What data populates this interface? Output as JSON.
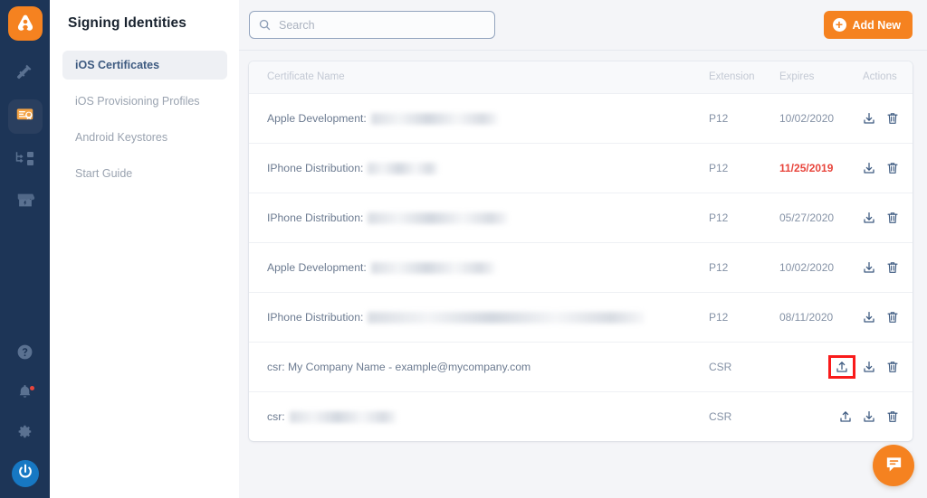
{
  "rail": {
    "logo_icon": "app-logo-icon",
    "items": [
      {
        "icon": "hammer-icon",
        "name": "rail-item-build",
        "active": false
      },
      {
        "icon": "certificate-icon",
        "name": "rail-item-signing-identities",
        "active": true
      },
      {
        "icon": "workflow-icon",
        "name": "rail-item-workflows",
        "active": false
      },
      {
        "icon": "store-icon",
        "name": "rail-item-marketplace",
        "active": false
      }
    ],
    "bottom": [
      {
        "icon": "help-circle-icon",
        "name": "rail-item-help"
      },
      {
        "icon": "bell-icon",
        "name": "rail-item-notifications",
        "badge": true
      },
      {
        "icon": "gear-icon",
        "name": "rail-item-settings"
      },
      {
        "icon": "power-icon",
        "name": "rail-item-account"
      }
    ]
  },
  "panel": {
    "title": "Signing Identities",
    "items": [
      {
        "label": "iOS Certificates",
        "active": true
      },
      {
        "label": "iOS Provisioning Profiles",
        "active": false
      },
      {
        "label": "Android Keystores",
        "active": false
      },
      {
        "label": "Start Guide",
        "active": false
      }
    ]
  },
  "topbar": {
    "search": {
      "value": "",
      "placeholder": "Search",
      "icon": "search-icon"
    },
    "add_button": {
      "label": "Add New",
      "icon": "plus-circle-icon",
      "color": "#f58220"
    }
  },
  "table": {
    "columns": {
      "name": "Certificate Name",
      "extension": "Extension",
      "expires": "Expires",
      "actions": "Actions"
    },
    "rows": [
      {
        "name": "Apple Development:",
        "redacted_width": 140,
        "extension": "P12",
        "expires": "10/02/2020",
        "expired": false,
        "has_upload": false,
        "highlight_upload": false
      },
      {
        "name": "IPhone Distribution:",
        "redacted_width": 78,
        "extension": "P12",
        "expires": "11/25/2019",
        "expired": true,
        "has_upload": false,
        "highlight_upload": false
      },
      {
        "name": "IPhone Distribution:",
        "redacted_width": 155,
        "extension": "P12",
        "expires": "05/27/2020",
        "expired": false,
        "has_upload": false,
        "highlight_upload": false
      },
      {
        "name": "Apple Development:",
        "redacted_width": 137,
        "extension": "P12",
        "expires": "10/02/2020",
        "expired": false,
        "has_upload": false,
        "highlight_upload": false
      },
      {
        "name": "IPhone Distribution:",
        "redacted_width": 306,
        "extension": "P12",
        "expires": "08/11/2020",
        "expired": false,
        "has_upload": false,
        "highlight_upload": false
      },
      {
        "name": "csr: My Company Name - example@mycompany.com",
        "redacted_width": 0,
        "extension": "CSR",
        "expires": "",
        "expired": false,
        "has_upload": true,
        "highlight_upload": true
      },
      {
        "name": "csr:",
        "redacted_width": 118,
        "extension": "CSR",
        "expires": "",
        "expired": false,
        "has_upload": true,
        "highlight_upload": false
      }
    ],
    "action_icons": {
      "upload": "upload-icon",
      "download": "download-icon",
      "delete": "trash-icon"
    },
    "highlight_color": "#f91b1b"
  },
  "fab": {
    "icon": "chat-message-icon",
    "color": "#f58220"
  },
  "colors": {
    "rail_bg": "#1d3557",
    "accent": "#f58220",
    "expired_red": "#e8453c",
    "page_bg": "#f4f5f8"
  }
}
